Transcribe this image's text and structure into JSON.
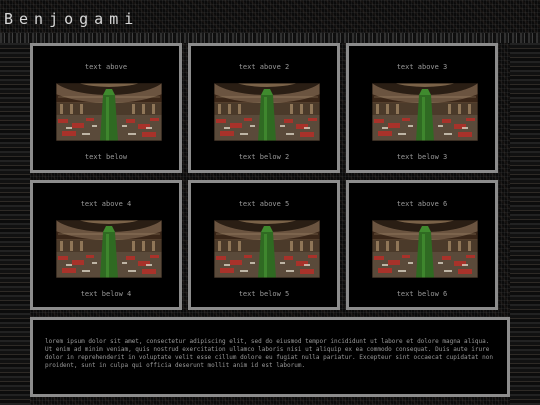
{
  "site": {
    "title": "Benjogami"
  },
  "cards": [
    {
      "above": "text above",
      "below": "text below"
    },
    {
      "above": "text above 2",
      "below": "text below 2"
    },
    {
      "above": "text above 3",
      "below": "text below 3"
    },
    {
      "above": "text above 4",
      "below": "text below 4"
    },
    {
      "above": "text above 5",
      "below": "text below 5"
    },
    {
      "above": "text above 6",
      "below": "text below 6"
    }
  ],
  "content": {
    "body": "lorem ipsum dolor sit amet, consectetur adipiscing elit, sed do eiusmod tempor incididunt ut labore et dolore magna aliqua. Ut enim ad minim veniam, quis nostrud exercitation ullamco laboris nisi ut aliquip ex ea commodo consequat. Duis aute irure dolor in reprehenderit in voluptate velit esse cillum dolore eu fugiat nulla pariatur. Excepteur sint occaecat cupidatat non proident, sunt in culpa qui officia deserunt mollit anim id est laborum."
  },
  "colors": {
    "frame": "#8c8c8c",
    "text": "#9a9a9a",
    "title": "#d8d8d8"
  }
}
